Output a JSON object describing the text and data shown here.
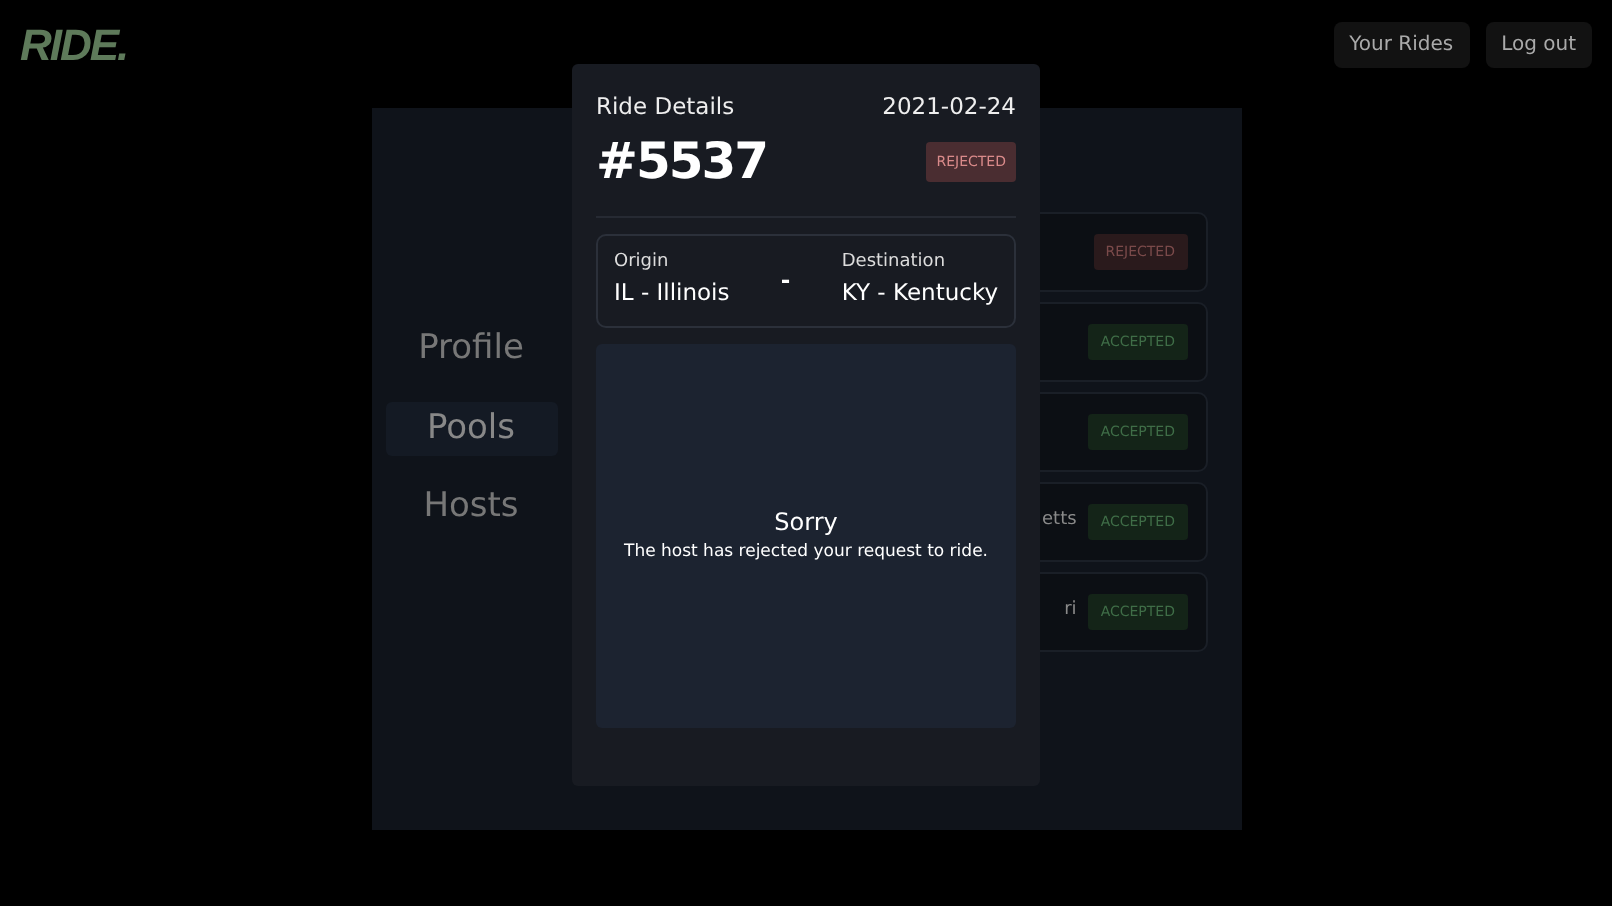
{
  "logo": "RIDE.",
  "nav_buttons": [
    "Your Rides",
    "Log out"
  ],
  "sidebar": {
    "items": [
      {
        "label": "Profile",
        "selected": false
      },
      {
        "label": "Pools",
        "selected": true
      },
      {
        "label": "Hosts",
        "selected": false
      }
    ]
  },
  "rides": [
    {
      "status": "REJECTED",
      "kind": "rejected"
    },
    {
      "status": "ACCEPTED",
      "kind": "accepted"
    },
    {
      "status": "ACCEPTED",
      "kind": "accepted"
    },
    {
      "text": "etts",
      "status": "ACCEPTED",
      "kind": "accepted"
    },
    {
      "text": "ri",
      "status": "ACCEPTED",
      "kind": "accepted"
    }
  ],
  "modal": {
    "title": "Ride Details",
    "date": "2021-02-24",
    "ride_number": "#5537",
    "status_badge": {
      "text": "REJECTED",
      "kind": "rejected"
    },
    "origin": {
      "label": "Origin",
      "value": "IL - Illinois"
    },
    "separator": "-",
    "destination": {
      "label": "Destination",
      "value": "KY - Kentucky"
    },
    "message": {
      "heading": "Sorry",
      "body": "The host has rejected your request to ride."
    }
  }
}
